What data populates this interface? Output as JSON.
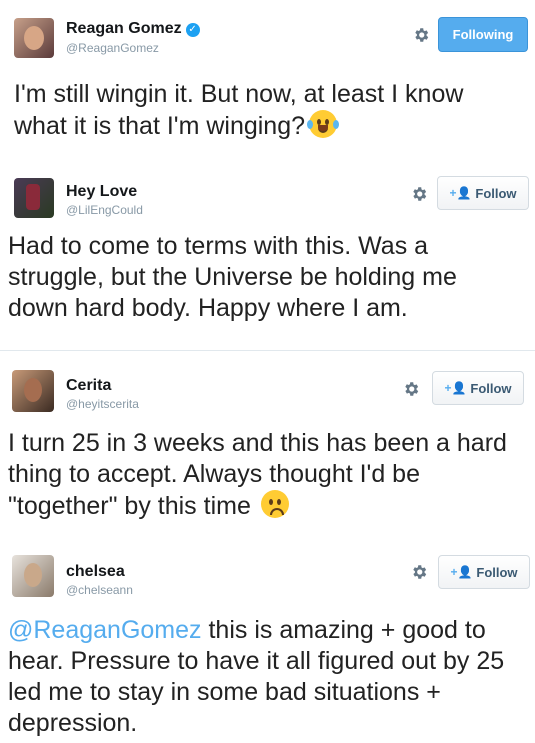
{
  "tweets": [
    {
      "name": "Reagan Gomez",
      "verified": true,
      "handle": "@ReaganGomez",
      "button_label": "Following",
      "lines": [
        "I'm still wingin it. But now, at least I know",
        "what it is that I'm winging?"
      ],
      "emoji": "face-with-tears-of-joy"
    },
    {
      "name": "Hey Love",
      "handle": "@LilEngCould",
      "button_label": "Follow",
      "lines": [
        "Had to come to terms with this. Was a",
        "struggle, but the Universe be holding me",
        "down hard body. Happy where I am."
      ]
    },
    {
      "name": "Cerita",
      "handle": "@heyitscerita",
      "button_label": "Follow",
      "lines": [
        "I turn 25 in 3 weeks and this has been a hard",
        "thing to accept. Always thought I'd be",
        "\"together\" by this time"
      ],
      "emoji": "worried-face"
    },
    {
      "name": "chelsea",
      "handle": "@chelseann",
      "button_label": "Follow",
      "mention": "@ReaganGomez",
      "lines": [
        " this is amazing + good to",
        "hear. Pressure to have it all figured out by 25",
        "led me to stay in some bad situations +",
        "depression."
      ]
    }
  ],
  "colors": {
    "accent": "#55acee",
    "handle": "#8899a6",
    "text": "#222222"
  }
}
